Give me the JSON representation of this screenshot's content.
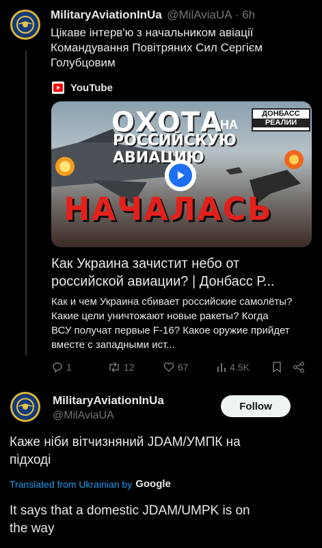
{
  "colors": {
    "background": "#000000",
    "text": "#e7e9ea",
    "muted": "#71767b",
    "link": "#1d9bf0",
    "youtube_red": "#ff0000"
  },
  "post1": {
    "author_name": "MilitaryAviationInUa",
    "handle": "@MilAviaUA",
    "separator": "·",
    "time": "6h",
    "text_lines": [
      "Цікаве інтерв'ю з начальником авіації",
      "Командування Повітряних Сил Сергієм",
      "Голубцовим"
    ],
    "source": {
      "label": "YouTube",
      "icon": "youtube-icon"
    },
    "thumbnail": {
      "title_top": "ОХОТА",
      "title_na": "НА",
      "title_mid": "РОССИЙСКУЮ АВИАЦИЮ",
      "title_red": "НАЧАЛАСЬ",
      "badge_top": "ДОНБАСС",
      "badge_bottom": "РЕАЛИИ",
      "play_icon": "play-icon"
    },
    "card": {
      "title_lines": [
        "Как Украина зачистит небо от",
        "российской авиации? | Донбасс Р..."
      ],
      "description_lines": [
        "Как и чем Украина сбивает российские самолёты?",
        "Какие цели уничтожают новые ракеты? Когда",
        "ВСУ получат первые F-16? Какое оружие прийдет",
        "вместе с западными ист..."
      ]
    },
    "actions": {
      "replies": "1",
      "reposts": "12",
      "likes": "67",
      "views": "4.5K"
    }
  },
  "post2": {
    "author_name": "MilitaryAviationInUa",
    "handle": "@MilAviaUA",
    "follow_label": "Follow",
    "text_lines": [
      "Каже ніби вітчизняний JDAM/УМПК на",
      "підході"
    ],
    "translated_prefix": "Translated from Ukrainian by",
    "translated_by": "Google",
    "translation_lines": [
      "It says that a domestic JDAM/UMPK is on",
      "the way"
    ]
  }
}
